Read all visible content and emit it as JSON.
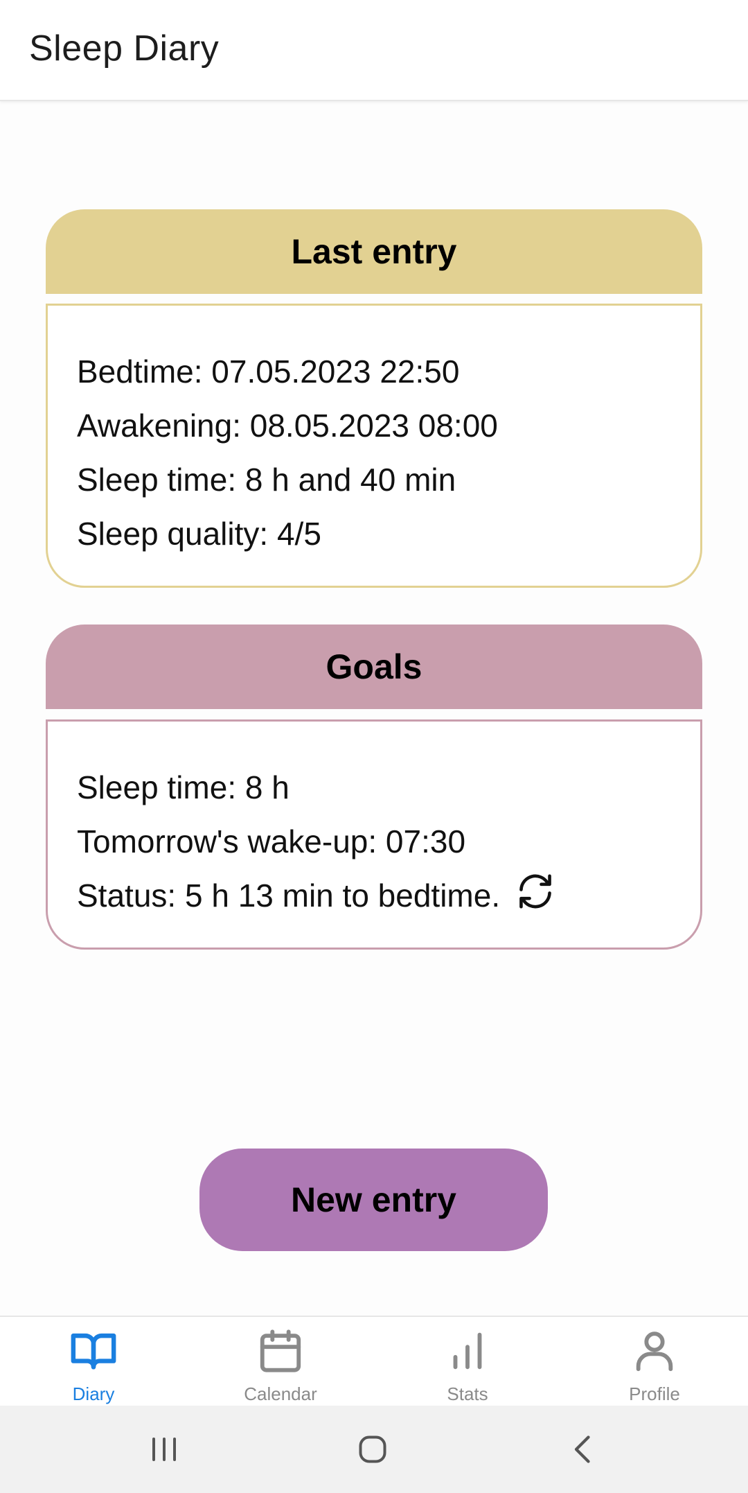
{
  "app": {
    "title": "Sleep Diary"
  },
  "last_entry": {
    "title": "Last entry",
    "bedtime": "Bedtime: 07.05.2023 22:50",
    "awakening": "Awakening: 08.05.2023 08:00",
    "sleep_time": "Sleep time: 8 h and 40 min",
    "sleep_quality": "Sleep quality: 4/5"
  },
  "goals": {
    "title": "Goals",
    "sleep_time": "Sleep time: 8 h",
    "wake_up": "Tomorrow's wake-up: 07:30",
    "status": "Status: 5 h 13 min to bedtime."
  },
  "actions": {
    "new_entry_label": "New entry"
  },
  "nav": {
    "items": [
      {
        "label": "Diary",
        "icon": "book-open-icon",
        "active": true
      },
      {
        "label": "Calendar",
        "icon": "calendar-icon",
        "active": false
      },
      {
        "label": "Stats",
        "icon": "bar-chart-icon",
        "active": false
      },
      {
        "label": "Profile",
        "icon": "user-icon",
        "active": false
      }
    ]
  },
  "colors": {
    "last_entry_accent": "#e2d192",
    "goals_accent": "#c99ead",
    "button": "#ae79b4",
    "nav_active": "#1a7fe0",
    "nav_inactive": "#8a8a8a"
  }
}
